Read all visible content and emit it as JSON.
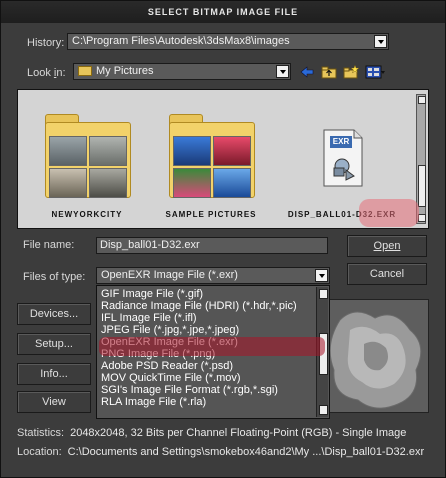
{
  "window": {
    "title": "SELECT BITMAP IMAGE FILE"
  },
  "history": {
    "label": "History:",
    "value": "C:\\Program Files\\Autodesk\\3dsMax8\\images"
  },
  "look_in": {
    "label": "Look in:",
    "value": "My Pictures"
  },
  "toolbar": {
    "icons": [
      "back-icon",
      "up-folder-icon",
      "new-folder-icon",
      "view-menu-icon"
    ]
  },
  "browser": {
    "items": [
      {
        "name": "NEWYORKCITY",
        "type": "folder"
      },
      {
        "name": "SAMPLE PICTURES",
        "type": "folder"
      },
      {
        "name": "DISP_BALL01-D32.EXR",
        "type": "file",
        "badge": "EXR"
      }
    ]
  },
  "file_name": {
    "label": "File name:",
    "value": "Disp_ball01-D32.exr"
  },
  "files_of_type": {
    "label": "Files of type:",
    "value": "OpenEXR Image File (*.exr)"
  },
  "file_type_options": [
    "GIF Image File (*.gif)",
    "Radiance Image File (HDRI) (*.hdr,*.pic)",
    "IFL Image File (*.ifl)",
    "JPEG File (*.jpg,*.jpe,*.jpeg)",
    "OpenEXR Image File (*.exr)",
    "PNG Image File (*.png)",
    "Adobe PSD Reader (*.psd)",
    "MOV QuickTime File (*.mov)",
    "SGI's Image File Format (*.rgb,*.sgi)",
    "RLA Image File (*.rla)"
  ],
  "buttons": {
    "open": "Open",
    "cancel": "Cancel",
    "devices": "Devices...",
    "setup": "Setup...",
    "info": "Info...",
    "view": "View"
  },
  "status": {
    "statistics_label": "Statistics:",
    "statistics_value": "2048x2048, 32 Bits per Channel Floating-Point (RGB) - Single Image",
    "location_label": "Location:",
    "location_value": "C:\\Documents and Settings\\smokebox46and2\\My ...\\Disp_ball01-D32.exr"
  },
  "colors": {
    "highlight": "#aa1428",
    "window_bg": "#3c3c3c"
  }
}
